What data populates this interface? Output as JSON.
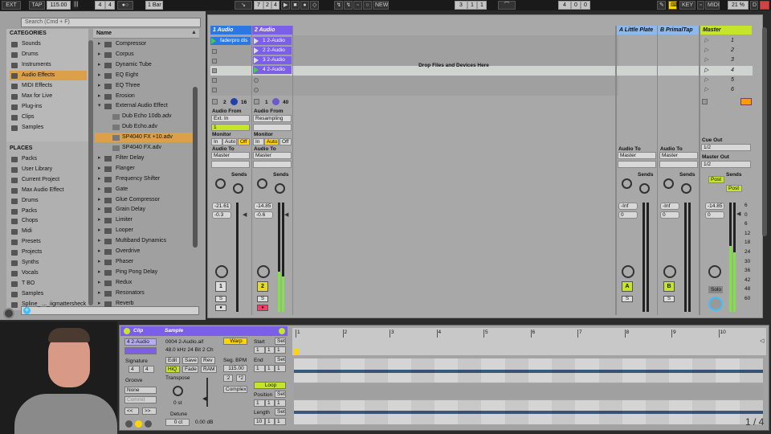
{
  "transport": {
    "ext": "EXT",
    "tap": "TAP",
    "tempo": "115.00",
    "sig_num": "4",
    "sig_den": "4",
    "quant": "1 Bar",
    "pos1": "7",
    "pos2": "2",
    "pos3": "4",
    "new": "NEW",
    "loop1": "3",
    "loop2": "1",
    "loop3": "1",
    "len1": "4",
    "len2": "0",
    "len3": "0",
    "key": "KEY",
    "midi": "MIDI",
    "cpu": "21 %",
    "io": "D"
  },
  "browser": {
    "search_placeholder": "Search (Cmd + F)",
    "categories_title": "CATEGORIES",
    "categories": [
      "Sounds",
      "Drums",
      "Instruments",
      "Audio Effects",
      "MIDI Effects",
      "Max for Live",
      "Plug-ins",
      "Clips",
      "Samples"
    ],
    "places_title": "PLACES",
    "places": [
      "Packs",
      "User Library",
      "Current Project",
      "Max Audio Effect",
      "Drums",
      "Packs",
      "Chops",
      "Midi",
      "Presets",
      "Projects",
      "Synths",
      "Vocals",
      "T BO",
      "Samples",
      "Spline_ ..._iigmattersheck"
    ],
    "name_header": "Name",
    "files": [
      "Compressor",
      "Corpus",
      "Dynamic Tube",
      "EQ Eight",
      "EQ Three",
      "Erosion",
      "External Audio Effect",
      "Dub Echo 10db.adv",
      "Dub Echo.adv",
      "SP4040 FX +10.adv",
      "SP4040 FX.adv",
      "Filter Delay",
      "Flanger",
      "Frequency Shifter",
      "Gate",
      "Glue Compressor",
      "Grain Delay",
      "Limiter",
      "Looper",
      "Multiband Dynamics",
      "Overdrive",
      "Phaser",
      "Ping Pong Delay",
      "Redux",
      "Resonators",
      "Reverb"
    ]
  },
  "session": {
    "tracks": [
      {
        "name": "1 Audio",
        "color": "#2b78e4"
      },
      {
        "name": "2 Audio",
        "color": "#7b5fe8"
      }
    ],
    "returns": [
      {
        "name": "A Little Plate"
      },
      {
        "name": "B PrimalTap"
      }
    ],
    "master": "Master",
    "clip1": "faderpro dis",
    "clips2": [
      "1 2-Audio",
      "2 2-Audio",
      "3 2-Audio",
      "4 2-Audio"
    ],
    "drop_text": "Drop Files and Devices Here",
    "scenes": [
      "1",
      "2",
      "3",
      "4",
      "5",
      "6"
    ],
    "t1": {
      "in_from": "Audio From",
      "in_src": "Ext. In",
      "in_ch": "1",
      "monitor": "Monitor",
      "mon": [
        "In",
        "Auto",
        "Off"
      ],
      "out": "Audio To",
      "out_dst": "Master",
      "sends": "Sends",
      "vol": "-21.61",
      "pan": "-0.3",
      "num": "1",
      "solo": "S",
      "io2": "2",
      "io16": "16"
    },
    "t2": {
      "in_from": "Audio From",
      "in_src": "Resampling",
      "monitor": "Monitor",
      "mon": [
        "In",
        "Auto",
        "Off"
      ],
      "out": "Audio To",
      "out_dst": "Master",
      "sends": "Sends",
      "vol": "-14.85",
      "pan": "-0.6",
      "num": "2",
      "solo": "S",
      "io1": "1",
      "io40": "40"
    },
    "rA": {
      "out": "Audio To",
      "out_dst": "Master",
      "sends": "Sends",
      "vol": "-Inf",
      "pan": "0",
      "letter": "A",
      "solo": "S"
    },
    "rB": {
      "out": "Audio To",
      "out_dst": "Master",
      "sends": "Sends",
      "vol": "-Inf",
      "pan": "0",
      "letter": "B",
      "solo": "S"
    },
    "mst": {
      "cue": "Cue Out",
      "cue_v": "1/2",
      "mout": "Master Out",
      "mout_v": "1/2",
      "sends": "Sends",
      "post": "Post",
      "vol": "-14.85",
      "pan": "0",
      "solo": "Solo",
      "scale": [
        "6",
        "0",
        "6",
        "12",
        "18",
        "24",
        "30",
        "36",
        "42",
        "48",
        "60"
      ]
    }
  },
  "clipview": {
    "clip_title": "Clip",
    "sample_title": "Sample",
    "clip_name": "4 2-Audio",
    "file": "0004 2-Audio.aif",
    "fmt": "48.0 kHz 24 Bit 2 Ch",
    "warp": "Warp",
    "edit": "Edit",
    "save": "Save",
    "rev": "Rev",
    "hiq": "HiQ",
    "fade": "Fade",
    "ram": "RAM",
    "transpose": "Transpose",
    "st": "0 st",
    "detune": "Detune",
    "ct": "0 ct",
    "db": "0.00 dB",
    "signature": "Signature",
    "sig_a": "4",
    "sig_b": "4",
    "groove": "Groove",
    "groove_v": "None",
    "commit": "Commit",
    "seg": "Seg. BPM",
    "bpm": "115.00",
    "half": ":2",
    "dbl": "*2",
    "complex": "Complex",
    "start": "Start",
    "set": "Set",
    "end": "End",
    "loop": "Loop",
    "position": "Position",
    "length": "Length",
    "s1": "1",
    "s2": "1",
    "s3": "1",
    "len": "10",
    "ruler": [
      "1",
      "2",
      "3",
      "4",
      "5",
      "6",
      "7",
      "8",
      "9",
      "10"
    ],
    "page": "1 / 4"
  }
}
